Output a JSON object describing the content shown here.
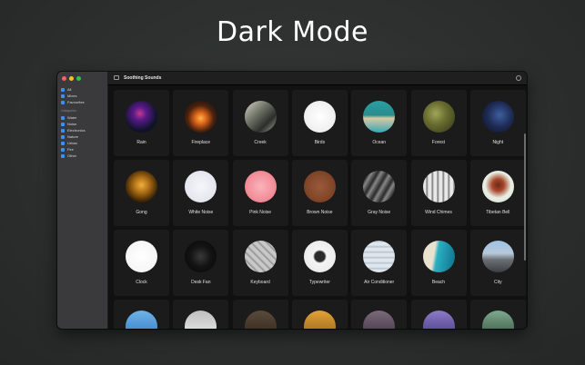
{
  "headline": "Dark Mode",
  "window": {
    "title": "Soothing Sounds",
    "traffic_colors": [
      "#fe5f57",
      "#febc2e",
      "#28c840"
    ],
    "toggle_icon": "sidebar-toggle-icon",
    "info_icon": "info-icon"
  },
  "sidebar": {
    "items": [
      {
        "label": "All",
        "icon": "waveform-icon"
      },
      {
        "label": "Mixes",
        "icon": "mix-icon"
      },
      {
        "label": "Favourites",
        "icon": "heart-icon"
      }
    ],
    "section_label": "Categories",
    "categories": [
      {
        "label": "Water",
        "icon": "water-icon"
      },
      {
        "label": "Noise",
        "icon": "noise-icon"
      },
      {
        "label": "Electronics",
        "icon": "electronics-icon"
      },
      {
        "label": "Nature",
        "icon": "leaf-icon"
      },
      {
        "label": "Urban",
        "icon": "building-icon"
      },
      {
        "label": "Fire",
        "icon": "flame-icon"
      },
      {
        "label": "Other",
        "icon": "ellipsis-icon"
      }
    ]
  },
  "sounds": [
    {
      "label": "Rain",
      "bg": "radial-gradient(circle at 45% 40%, #c33b8e 0%, #5a1a8a 25%, #10132c 65%, #05060f 100%)"
    },
    {
      "label": "Fireplace",
      "bg": "radial-gradient(circle at 50% 55%, #ffb347 0%, #d9621a 25%, #4a220e 55%, #150905 100%)"
    },
    {
      "label": "Creek",
      "bg": "linear-gradient(135deg, #d8d4c8 0%, #6f7266 40%, #2b2f2a 70%, #a4a89a 100%)"
    },
    {
      "label": "Birds",
      "bg": "radial-gradient(circle at 50% 50%, #ffffff 0%, #efefef 70%, #d6d6d6 100%)"
    },
    {
      "label": "Ocean",
      "bg": "linear-gradient(180deg, #2a9fa4 0%, #2a8c8c 45%, #d7c9a5 55%, #35a7b4 100%)"
    },
    {
      "label": "Forest",
      "bg": "radial-gradient(circle at 40% 40%, #a0a65a 0%, #6a6d2f 40%, #2f3317 100%)"
    },
    {
      "label": "Night",
      "bg": "radial-gradient(circle at 55% 45%, #3d5fa0 0%, #1d2a52 50%, #0b1024 100%)"
    },
    {
      "label": "Gong",
      "bg": "radial-gradient(circle at 50% 45%, #f0b13f 0%, #a76a14 35%, #3a2306 70%, #0e0803 100%)"
    },
    {
      "label": "White Noise",
      "bg": "radial-gradient(circle at 50% 50%, #f5f6fa 0%, #e4e6ee 70%, #cfd2dc 100%)"
    },
    {
      "label": "Pink Noise",
      "bg": "radial-gradient(circle at 50% 50%, #fbb3bb 0%, #f28e99 60%, #e0707d 100%)"
    },
    {
      "label": "Brown Noise",
      "bg": "radial-gradient(circle at 50% 50%, #9a5a3a 0%, #7f4428 65%, #5e3018 100%)"
    },
    {
      "label": "Gray Noise",
      "bg": "repeating-linear-gradient(120deg, #8c8c8c 0px, #5a5a5a 3px, #2a2a2a 6px, #7a7a7a 9px)"
    },
    {
      "label": "Wind Chimes",
      "bg": "repeating-linear-gradient(90deg, #e8e8e8 0px, #e8e8e8 3px, #6d6d6d 4px, #e8e8e8 6px)"
    },
    {
      "label": "Tibetan Bell",
      "bg": "radial-gradient(circle at 50% 45%, #6c2b17 0%, #a8462a 25%, #e9efe4 55%, #cfd9cc 100%)"
    },
    {
      "label": "Clock",
      "bg": "radial-gradient(circle at 50% 50%, #ffffff 0%, #f2f2f2 100%)"
    },
    {
      "label": "Desk Fan",
      "bg": "radial-gradient(circle at 50% 50%, #3a3a3a 0%, #141414 45%, #050505 100%)"
    },
    {
      "label": "Keyboard",
      "bg": "repeating-linear-gradient(45deg, #c8c8c8 0px, #c8c8c8 3px, #8f8f8f 4px, #c8c8c8 6px)"
    },
    {
      "label": "Typewriter",
      "bg": "radial-gradient(circle at 50% 50%, #2a2a2a 0%, #2a2a2a 22%, #f4f4f4 30%, #e6e6e6 100%)"
    },
    {
      "label": "Air Conditioner",
      "bg": "repeating-linear-gradient(0deg, #dfe6ec 0px, #dfe6ec 3px, #b4c0ca 4px, #dfe6ec 6px)"
    },
    {
      "label": "Beach",
      "bg": "linear-gradient(100deg, #e9e2cf 0%, #e9e2cf 35%, #2ab0c2 45%, #0e6f8a 100%)"
    },
    {
      "label": "City",
      "bg": "linear-gradient(180deg, #9ec3e6 0%, #b8c8d8 40%, #6b6f74 60%, #3b3e42 100%)"
    },
    {
      "label": "",
      "bg": "linear-gradient(180deg, #6fb2e8 0%, #2f77c0 100%)"
    },
    {
      "label": "",
      "bg": "linear-gradient(180deg, #bfbfbf 0%, #f0f0f0 100%)"
    },
    {
      "label": "",
      "bg": "linear-gradient(180deg, #5a4a3a 0%, #2b2218 100%)"
    },
    {
      "label": "",
      "bg": "linear-gradient(180deg, #e2a23a 0%, #8a5a10 100%)"
    },
    {
      "label": "",
      "bg": "linear-gradient(180deg, #7a6a7a 0%, #3a2d3a 100%)"
    },
    {
      "label": "",
      "bg": "linear-gradient(180deg, #8d7ac8 0%, #3b3276 100%)"
    },
    {
      "label": "",
      "bg": "linear-gradient(180deg, #7ea98d 0%, #2d4a38 100%)"
    }
  ]
}
